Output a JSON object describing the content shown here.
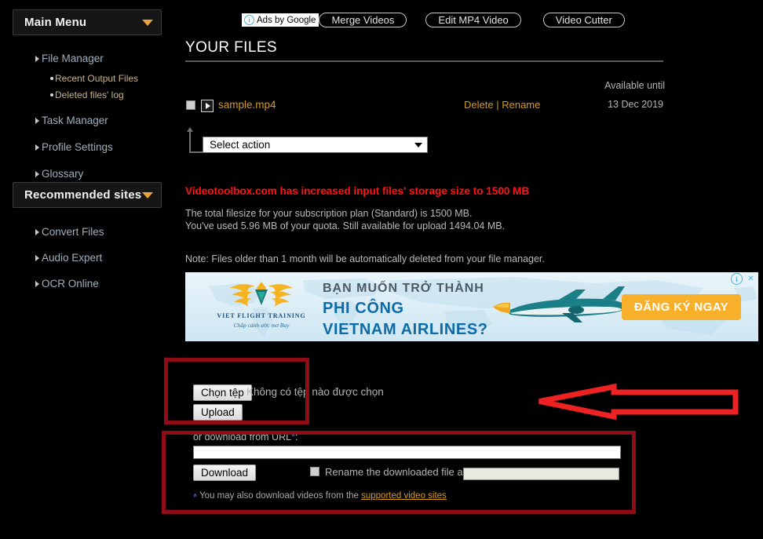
{
  "colors": {
    "accent_orange": "#d99a1c",
    "alert_red": "#ff1313",
    "annotation_box": "#8e0d17",
    "annotation_arrow": "#ee2222",
    "sidebar_link": "#9fb0bd",
    "ad_blue": "#0d6ba8",
    "ad_cta_bg": "#f8b02a"
  },
  "sidebar": {
    "main_menu": {
      "title": "Main Menu",
      "caret_icon": "chevron-down-icon",
      "items": [
        {
          "label": "File Manager",
          "subitems": [
            "Recent Output Files",
            "Deleted files' log"
          ]
        },
        {
          "label": "Task Manager",
          "subitems": []
        },
        {
          "label": "Profile Settings",
          "subitems": []
        },
        {
          "label": "Glossary",
          "subitems": []
        }
      ]
    },
    "recommended": {
      "title": "Recommended sites",
      "caret_icon": "chevron-down-icon",
      "items": [
        {
          "label": "Convert Files"
        },
        {
          "label": "Audio Expert"
        },
        {
          "label": "OCR Online"
        }
      ]
    }
  },
  "adtoolbar": {
    "badge_label": "Ads by Google",
    "badge_icon": "info-icon",
    "pills": [
      "Merge Videos",
      "Edit MP4 Video",
      "Video Cutter"
    ]
  },
  "files_section": {
    "heading": "YOUR FILES",
    "available_until_label": "Available until",
    "rows": [
      {
        "name": "sample.mp4",
        "delete_label": "Delete",
        "separator": "|",
        "rename_label": "Rename",
        "available_until": "13 Dec 2019",
        "checkbox_checked": false,
        "play_icon": "play-icon"
      }
    ],
    "select_action": {
      "value": "Select action",
      "caret_icon": "caret-down-icon"
    }
  },
  "notice": {
    "headline": "Videotoolbox.com has increased input files' storage size to 1500 MB",
    "quota_line_1": "The total filesize for your subscription plan (Standard) is 1500 MB.",
    "quota_line_2": "You've used 5.96 MB of your quota. Still available for upload 1494.04 MB.",
    "note": "Note: Files older than 1 month will be automatically deleted from your file manager."
  },
  "ad_banner": {
    "line1": "BẠN MUỐN TRỞ THÀNH",
    "line2": "PHI CÔNG",
    "line3": "VIETNAM AIRLINES?",
    "cta": "ĐĂNG KÝ NGAY",
    "logo_name": "VIET FLIGHT TRAINING",
    "logo_tagline": "Chắp cánh ước mơ Bay",
    "info_icon": "info-icon",
    "close_icon": "close-icon"
  },
  "upload": {
    "choose_file_button": "Chọn tệp",
    "file_status": "Không có tệp nào được chọn",
    "upload_button": "Upload"
  },
  "download": {
    "url_label": "or download from URL",
    "url_label_star": "*",
    "url_label_colon": ":",
    "url_value": "",
    "download_button": "Download",
    "rename_checkbox_label": "Rename the downloaded file as",
    "rename_checkbox_checked": false,
    "rename_value": "",
    "hint_star": "*",
    "hint_text": "You may also download videos from the ",
    "hint_link": "supported video sites"
  }
}
